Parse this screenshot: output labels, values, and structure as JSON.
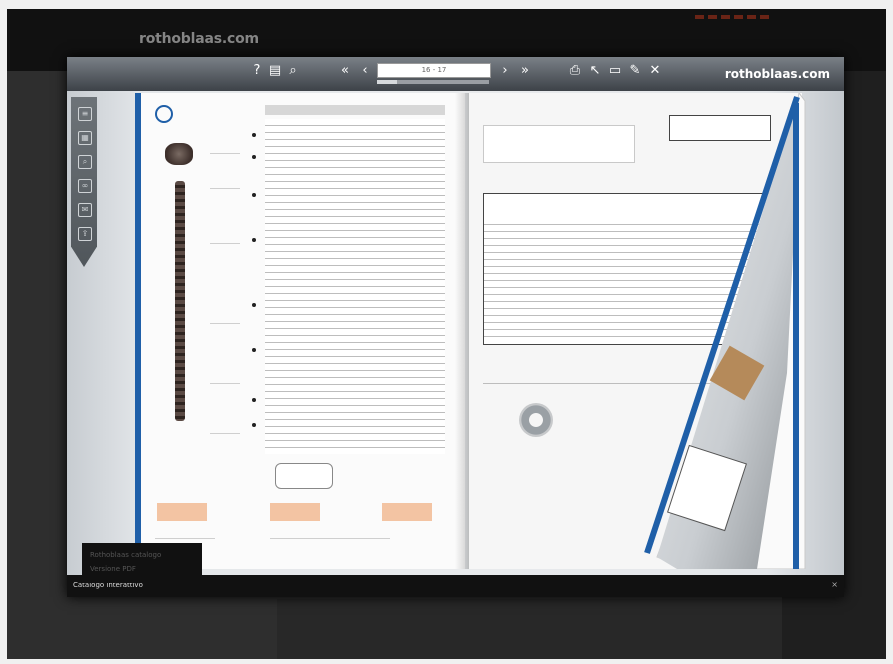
{
  "site": {
    "logo_text": "rothoblaas.com"
  },
  "viewer": {
    "logo_text": "rothoblaas.com",
    "page_indicator": "16 - 17",
    "page_progress": 0.18,
    "toolbar_icons": [
      "help-icon",
      "contents-icon",
      "zoom-icon",
      "first-page-icon",
      "previous-page-icon",
      "next-page-icon",
      "last-page-icon",
      "print-icon",
      "pointer-icon",
      "download-icon",
      "edit-icon",
      "fullscreen-icon"
    ],
    "side_tabs": [
      "bookmark-icon",
      "thumbnails-icon",
      "search-icon",
      "link-icon",
      "notes-icon",
      "share-icon"
    ],
    "caption_text": "Catalogo interattivo",
    "caption_close": "×"
  },
  "menu": {
    "items": [
      "Rothoblaas catalogo",
      "Versione PDF"
    ]
  },
  "colors": {
    "accent_blue": "#1f5fa8",
    "brand_dark_red": "#6a2416"
  }
}
